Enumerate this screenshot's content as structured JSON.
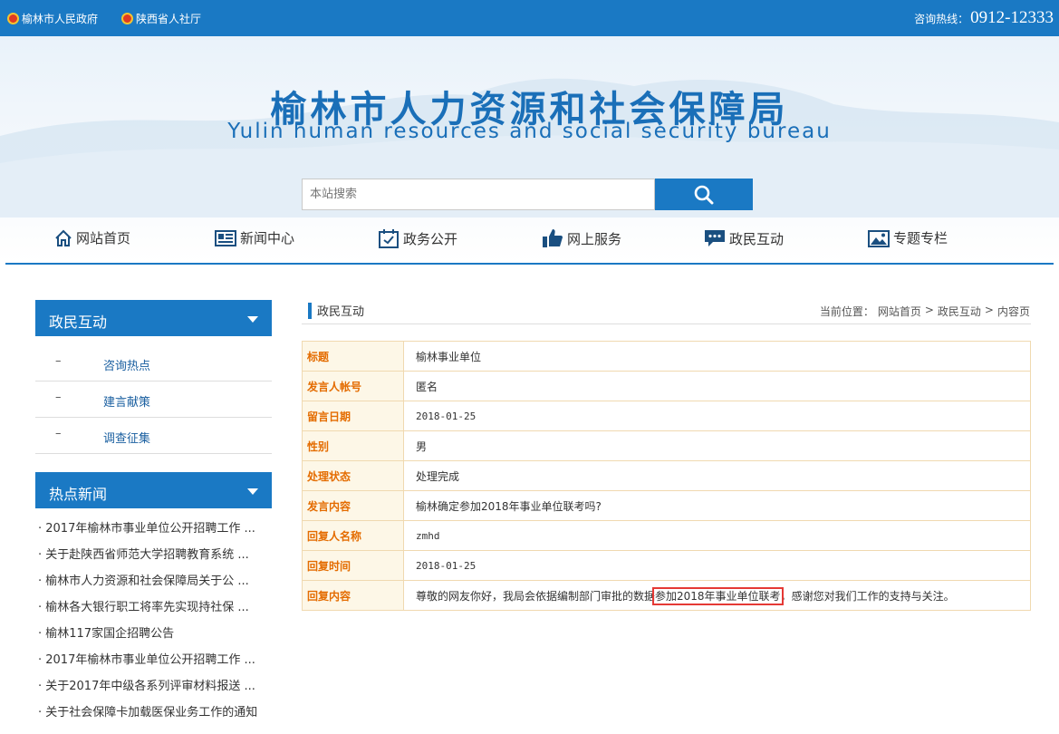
{
  "topbar": {
    "links": [
      "榆林市人民政府",
      "陕西省人社厅"
    ],
    "hotline_label": "咨询热线：",
    "hotline_number": "0912-12333"
  },
  "banner": {
    "title_cn": "榆林市人力资源和社会保障局",
    "title_en": "Yulin human resources and social security bureau"
  },
  "search": {
    "placeholder": "本站搜索"
  },
  "nav": [
    {
      "label": "网站首页",
      "icon": "home-icon"
    },
    {
      "label": "新闻中心",
      "icon": "newspaper-icon"
    },
    {
      "label": "政务公开",
      "icon": "calendar-check-icon"
    },
    {
      "label": "网上服务",
      "icon": "thumbs-up-icon"
    },
    {
      "label": "政民互动",
      "icon": "chat-bubble-icon"
    },
    {
      "label": "专题专栏",
      "icon": "picture-icon"
    }
  ],
  "sidebar": {
    "section1_title": "政民互动",
    "section1_items": [
      "咨询热点",
      "建言献策",
      "调查征集"
    ],
    "dash": "–",
    "section2_title": "热点新闻",
    "hot_news": [
      "· 2017年榆林市事业单位公开招聘工作 ...",
      "· 关于赴陕西省师范大学招聘教育系统 ...",
      "· 榆林市人力资源和社会保障局关于公 ...",
      "· 榆林各大银行职工将率先实现持社保 ...",
      "· 榆林117家国企招聘公告",
      "· 2017年榆林市事业单位公开招聘工作 ...",
      "· 关于2017年中级各系列评审材料报送 ...",
      "· 关于社会保障卡加载医保业务工作的通知"
    ]
  },
  "content": {
    "section_title": "政民互动",
    "breadcrumb": {
      "label": "当前位置：",
      "items": [
        "网站首页",
        "政民互动",
        "内容页"
      ],
      "sep": ">"
    },
    "rows": [
      {
        "key": "标题",
        "value": "榆林事业单位"
      },
      {
        "key": "发言人帐号",
        "value": "匿名"
      },
      {
        "key": "留言日期",
        "value": "2018-01-25"
      },
      {
        "key": "性别",
        "value": "男"
      },
      {
        "key": "处理状态",
        "value": "处理完成"
      },
      {
        "key": "发言内容",
        "value": "榆林确定参加2018年事业单位联考吗?"
      },
      {
        "key": "回复人名称",
        "value": "zmhd"
      },
      {
        "key": "回复时间",
        "value": "2018-01-25"
      },
      {
        "key": "回复内容",
        "value_pre": "尊敬的网友你好，我局会依据编制部门审批的数据",
        "value_hl": "参加2018年事业单位联考",
        "value_post": "，感谢您对我们工作的支持与关注。"
      }
    ]
  },
  "colors": {
    "primary": "#1a79c4",
    "label_orange": "#e46c00",
    "highlight_red": "#e53935"
  }
}
